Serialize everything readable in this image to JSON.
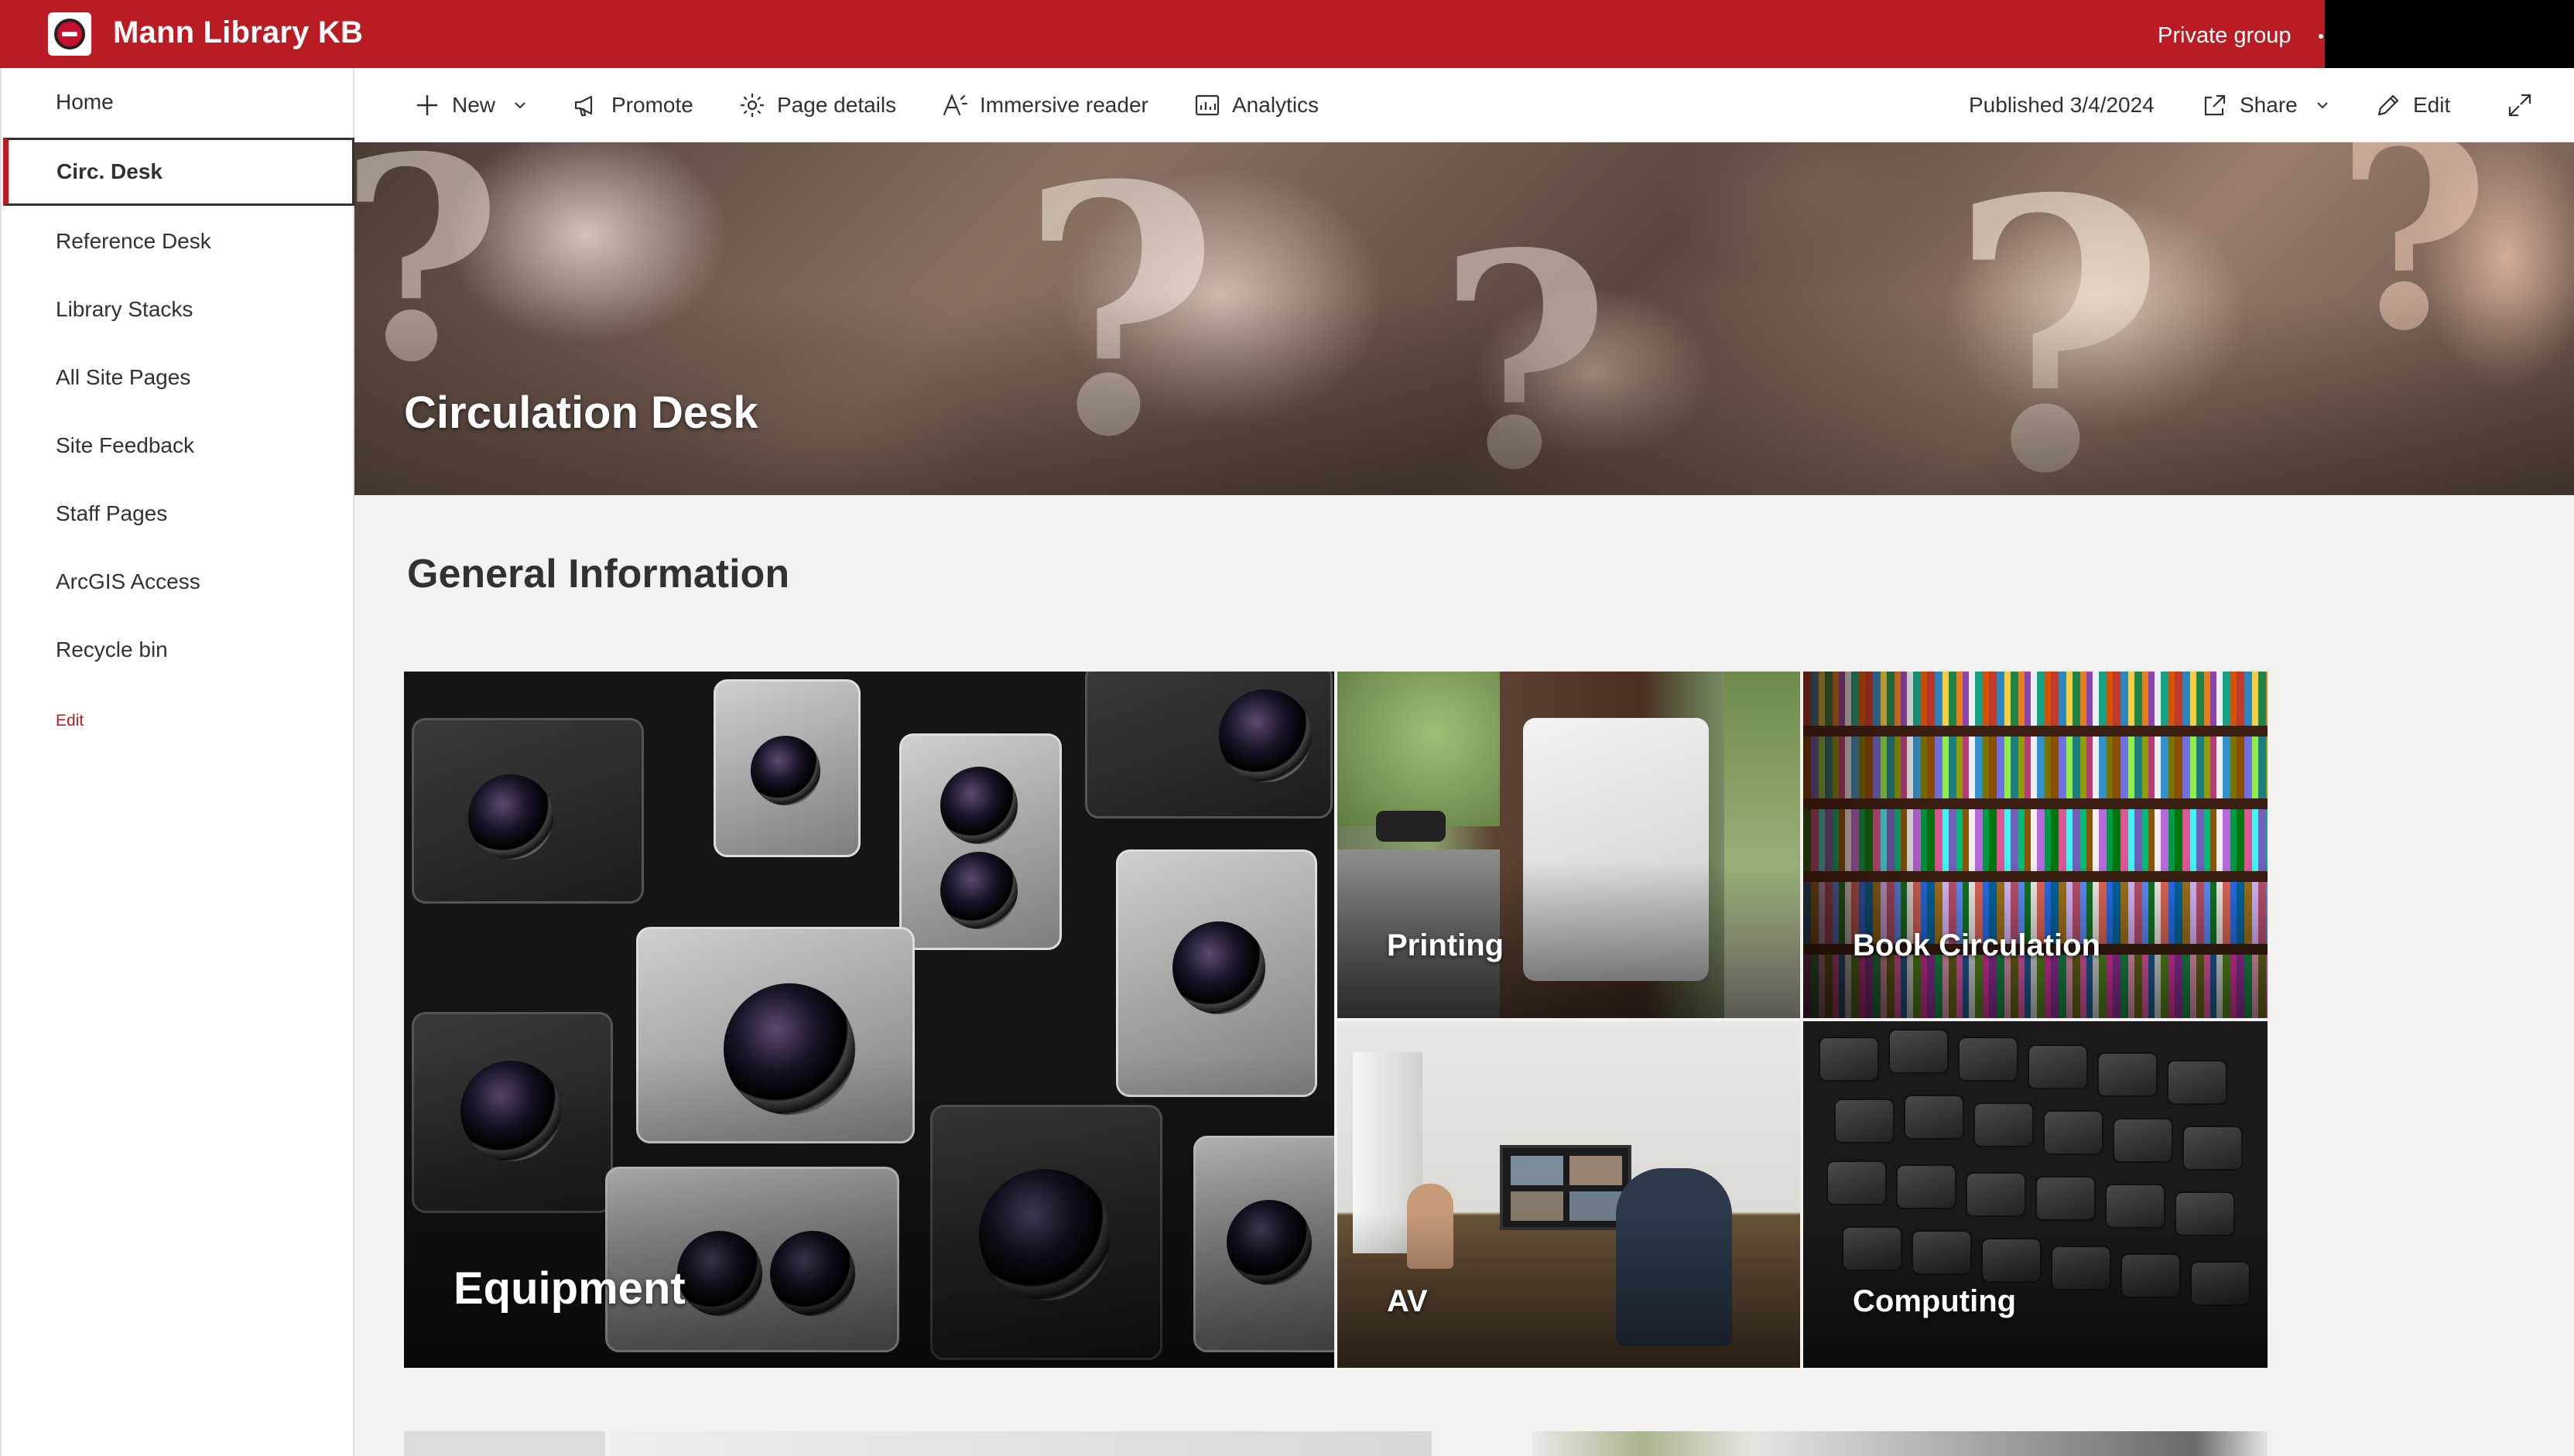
{
  "suite_bar": {
    "site_title": "Mann Library KB",
    "group_label": "Private group",
    "brand_color": "#b91c22"
  },
  "left_nav": {
    "items": [
      {
        "label": "Home",
        "selected": false
      },
      {
        "label": "Circ. Desk",
        "selected": true
      },
      {
        "label": "Reference Desk",
        "selected": false
      },
      {
        "label": "Library Stacks",
        "selected": false
      },
      {
        "label": "All Site Pages",
        "selected": false
      },
      {
        "label": "Site Feedback",
        "selected": false
      },
      {
        "label": "Staff Pages",
        "selected": false
      },
      {
        "label": "ArcGIS Access",
        "selected": false
      },
      {
        "label": "Recycle bin",
        "selected": false
      }
    ],
    "edit_label": "Edit"
  },
  "command_bar": {
    "new_label": "New",
    "promote_label": "Promote",
    "page_details_label": "Page details",
    "immersive_reader_label": "Immersive reader",
    "analytics_label": "Analytics",
    "published_label": "Published 3/4/2024",
    "share_label": "Share",
    "edit_label": "Edit"
  },
  "hero": {
    "title": "Circulation Desk"
  },
  "section": {
    "title": "General Information"
  },
  "tiles": [
    {
      "label": "Equipment",
      "icon": "camera-photo"
    },
    {
      "label": "Printing",
      "icon": "printer-photo"
    },
    {
      "label": "Book Circulation",
      "icon": "bookshelf-photo"
    },
    {
      "label": "AV",
      "icon": "meeting-room-photo"
    },
    {
      "label": "Computing",
      "icon": "keyboard-photo"
    }
  ]
}
